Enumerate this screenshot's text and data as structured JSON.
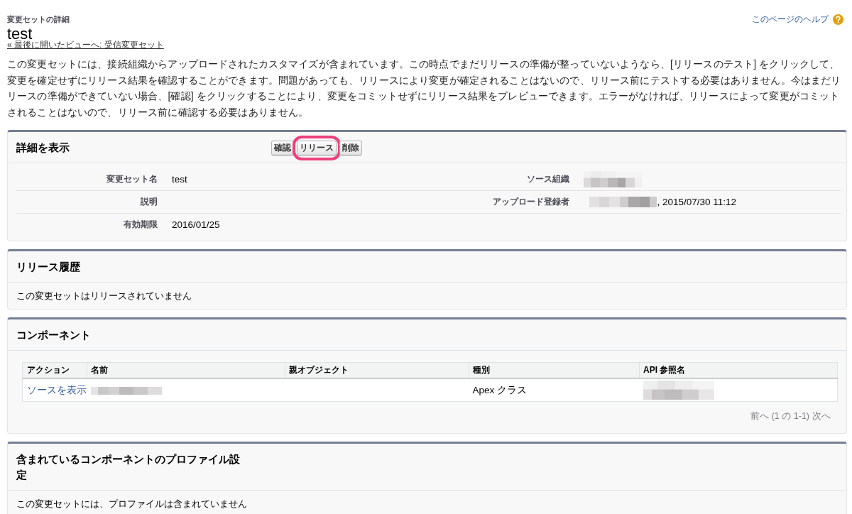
{
  "page_header": {
    "type_label": "変更セットの詳細",
    "title": "test",
    "back_link": "« 最後に開いたビューへ: 受信変更セット",
    "help_link": "このページのヘルプ"
  },
  "description": "この変更セットには、接続組織からアップロードされたカスタマイズが含まれています。この時点でまだリリースの準備が整っていないようなら、[リリースのテスト] をクリックして、変更を確定せずにリリース結果を確認することができます。問題があっても、リリースにより変更が確定されることはないので、リリース前にテストする必要はありません。今はまだリリースの準備ができていない場合、[確認] をクリックすることにより、変更をコミットせずにリリース結果をプレビューできます。エラーがなければ、リリースによって変更がコミットされることはないので、リリース前に確認する必要はありません。",
  "sections": [
    {
      "kind": "details",
      "title": "詳細を表示",
      "buttons": [
        {
          "label": "確認",
          "highlighted": false
        },
        {
          "label": "リリース",
          "highlighted": true
        },
        {
          "label": "削除",
          "highlighted": false
        }
      ],
      "rows": [
        {
          "cells": [
            {
              "label": "変更セット名",
              "value": "test",
              "redacted": false
            },
            {
              "label": "ソース組織",
              "redacted": true
            }
          ]
        },
        {
          "cells": [
            {
              "label": "説明",
              "redacted": false
            },
            {
              "label": "アップロード登録者",
              "value": ", 2015/07/30 11:12",
              "redacted": true
            }
          ]
        },
        {
          "cells": [
            {
              "label": "有効期限",
              "value": "2016/01/25",
              "redacted": false
            }
          ]
        }
      ]
    },
    {
      "kind": "message",
      "title": "リリース履歴",
      "message": "この変更セットはリリースされていません"
    },
    {
      "kind": "table",
      "title": "コンポーネント",
      "columns": [
        "アクション",
        "名前",
        "親オブジェクト",
        "種別",
        "API 参照名"
      ],
      "rows": [
        {
          "cells": [
            {
              "kind": "link",
              "text": "ソースを表示"
            },
            {
              "kind": "redacted"
            },
            {
              "kind": "empty"
            },
            {
              "kind": "text",
              "text": "Apex クラス"
            },
            {
              "kind": "redacted"
            }
          ]
        }
      ],
      "pagination": {
        "prev": {
          "label": "前へ",
          "disabled": true
        },
        "summary": "(1 の 1-1)",
        "next": {
          "label": "次へ",
          "disabled": true
        }
      }
    },
    {
      "kind": "message",
      "title": "含まれているコンポーネントのプロファイル設定",
      "message": "この変更セットには、プロファイルは含まれていません"
    }
  ]
}
